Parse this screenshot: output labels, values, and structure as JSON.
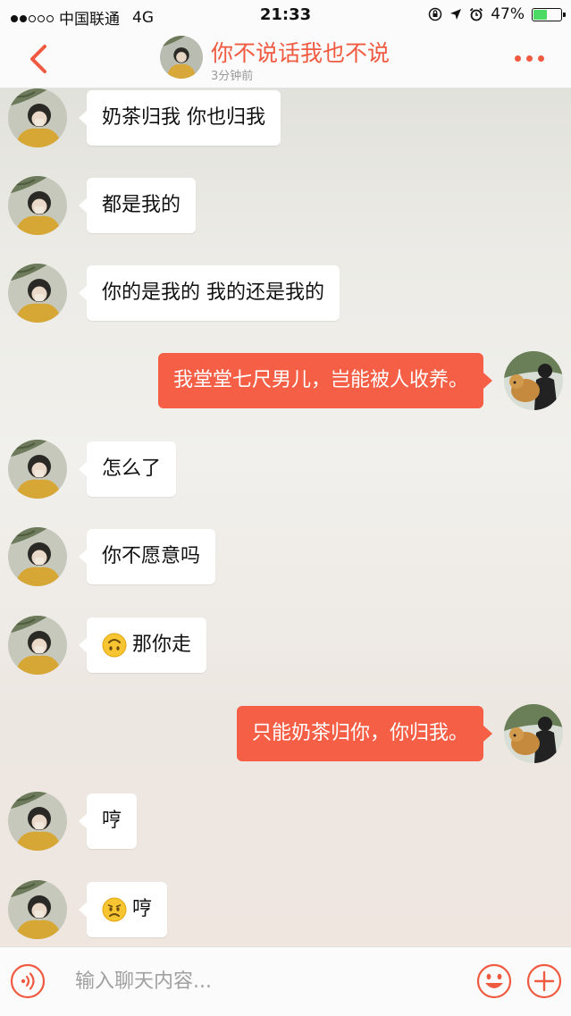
{
  "status_bar": {
    "carrier": "中国联通",
    "network": "4G",
    "time": "21:33",
    "battery": "47%",
    "battery_level": 0.47,
    "icons": [
      "orientation-lock-icon",
      "location-icon",
      "alarm-icon"
    ]
  },
  "header": {
    "title": "你不说话我也不说",
    "subtitle": "3分钟前",
    "accent_color": "#f05a40"
  },
  "messages": [
    {
      "side": "in",
      "text": "奶茶归我 你也归我"
    },
    {
      "side": "in",
      "text": "都是我的"
    },
    {
      "side": "in",
      "text": "你的是我的 我的还是我的"
    },
    {
      "side": "out",
      "text": "我堂堂七尺男儿，岂能被人收养。"
    },
    {
      "side": "in",
      "text": "怎么了"
    },
    {
      "side": "in",
      "text": "你不愿意吗"
    },
    {
      "side": "in",
      "emoji": "upside-down-face-emoji",
      "text": "那你走"
    },
    {
      "side": "out",
      "text": "只能奶茶归你，你归我。"
    },
    {
      "side": "in",
      "text": "哼"
    },
    {
      "side": "in",
      "emoji": "worried-face-emoji",
      "text": "哼"
    }
  ],
  "input": {
    "placeholder": "输入聊天内容..."
  },
  "colors": {
    "outgoing_bubble": "#f45f46",
    "incoming_bubble": "#ffffff"
  }
}
